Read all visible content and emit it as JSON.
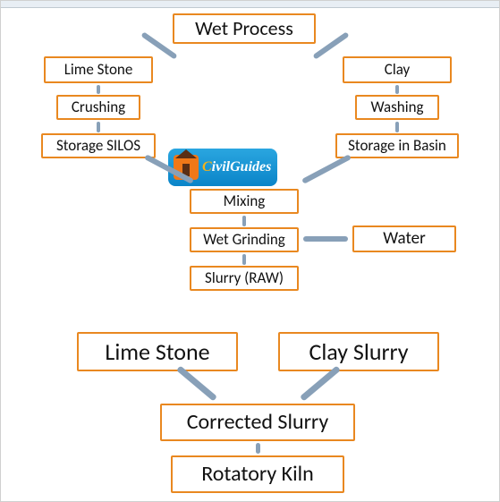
{
  "title": "Wet Process",
  "left_branch": {
    "step1": "Lime Stone",
    "step2": "Crushing",
    "step3": "Storage SILOS"
  },
  "right_branch": {
    "step1": "Clay",
    "step2": "Washing",
    "step3": "Storage in Basin"
  },
  "center": {
    "mixing": "Mixing",
    "wet_grinding": "Wet Grinding",
    "slurry_raw": "Slurry (RAW)"
  },
  "water": "Water",
  "logo": {
    "prefix": "C",
    "rest": "ivilGuides"
  },
  "bottom": {
    "lime_stone": "Lime Stone",
    "clay_slurry": "Clay Slurry",
    "corrected_slurry": "Corrected Slurry",
    "rotatory_kiln": "Rotatory Kiln"
  }
}
